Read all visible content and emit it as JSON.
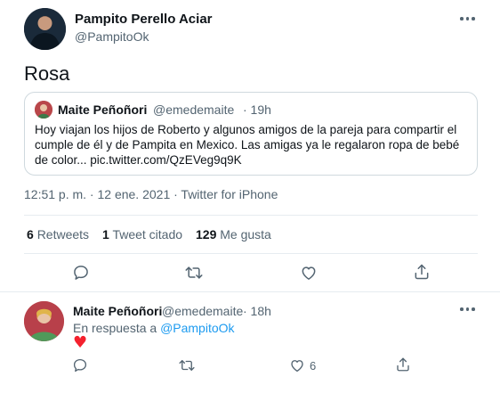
{
  "tweet": {
    "author_name": "Pampito Perello Aciar",
    "author_handle": "@PampitoOk",
    "text": "Rosa",
    "meta": "12:51 p. m. · 12 ene. 2021 · Twitter for iPhone",
    "stats": {
      "retweets_count": "6",
      "retweets_label": "Retweets",
      "quotes_count": "1",
      "quotes_label": "Tweet citado",
      "likes_count": "129",
      "likes_label": "Me gusta"
    }
  },
  "quoted": {
    "author_name": "Maite Peñoñori",
    "author_handle": "@emedemaite",
    "time": "· 19h",
    "text": "Hoy viajan los hijos de Roberto y algunos amigos de la pareja para compartir el cumple de él y de Pampita en Mexico. Las amigas ya le regalaron ropa de bebé de color... pic.twitter.com/QzEVeg9q9K"
  },
  "reply": {
    "author_name": "Maite Peñoñori",
    "author_handle": "@emedemaite",
    "time": "· 18h",
    "reply_prefix": "En respuesta a",
    "reply_to": "@PampitoOk",
    "emoji": "♥",
    "like_count": "6"
  },
  "colors": {
    "text": "#0f1419",
    "muted": "#536471",
    "link": "#1d9bf0",
    "heart": "#f4212e",
    "border": "#cfd9de"
  }
}
